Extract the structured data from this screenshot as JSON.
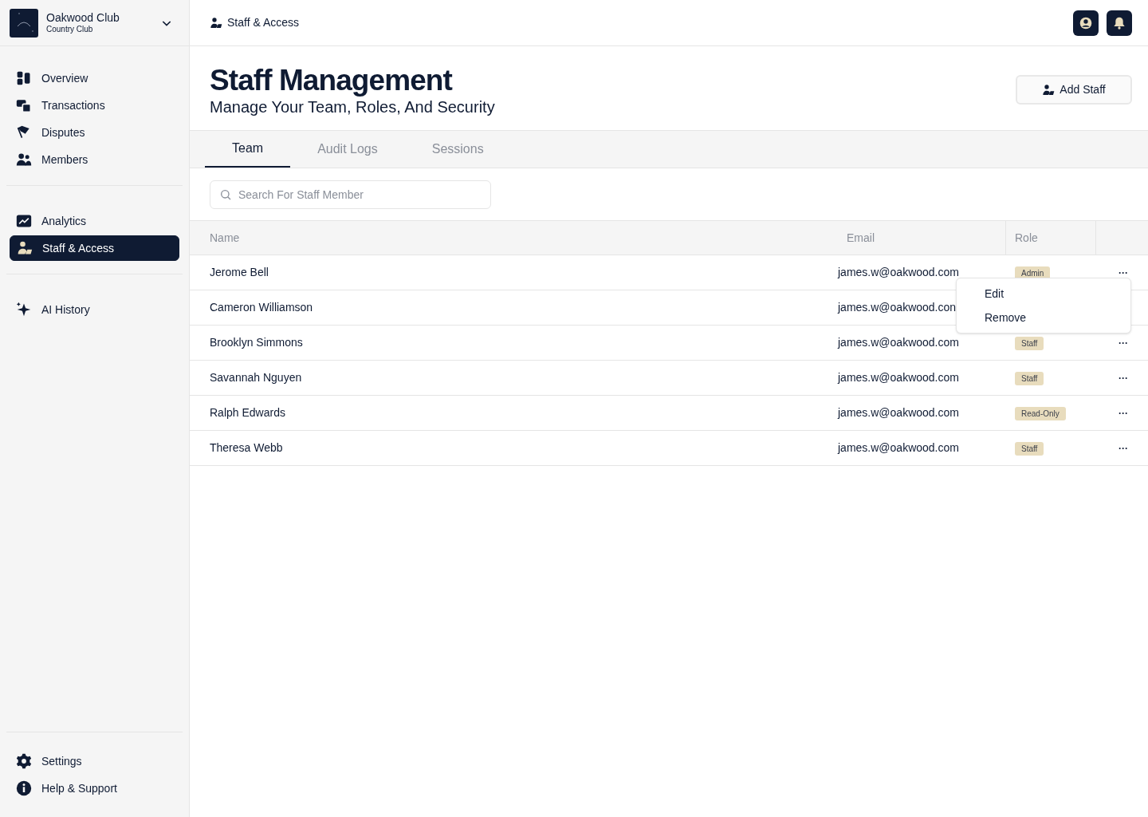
{
  "brand": {
    "name": "Oakwood Club",
    "subtitle": "Country Club"
  },
  "nav_groups": [
    {
      "items": [
        {
          "label": "Overview",
          "selected": false
        },
        {
          "label": "Transactions",
          "selected": false
        },
        {
          "label": "Disputes",
          "selected": false
        },
        {
          "label": "Members",
          "selected": false
        }
      ]
    },
    {
      "items": [
        {
          "label": "Analytics",
          "selected": false
        },
        {
          "label": "Staff & Access",
          "selected": true
        }
      ]
    },
    {
      "items": [
        {
          "label": "AI History",
          "selected": false
        }
      ]
    }
  ],
  "nav_footer": [
    {
      "label": "Settings"
    },
    {
      "label": "Help & Support"
    }
  ],
  "breadcrumb": "Staff & Access",
  "page": {
    "title": "Staff Management",
    "subtitle": "Manage Your Team, Roles, And Security",
    "action": "Add Staff"
  },
  "tabs": [
    {
      "label": "Team",
      "selected": true
    },
    {
      "label": "Audit Logs",
      "selected": false
    },
    {
      "label": "Sessions",
      "selected": false
    }
  ],
  "search": {
    "placeholder": "Search For Staff Member"
  },
  "table": {
    "columns": [
      "Name",
      "Email",
      "Role"
    ],
    "rows": [
      {
        "name": "Jerome Bell",
        "email": "james.w@oakwood.com",
        "role": "Admin",
        "actions": "···"
      },
      {
        "name": "Cameron Williamson",
        "email": "james.w@oakwood.con"
      },
      {
        "name": "Brooklyn Simmons",
        "email": "james.w@oakwood.com",
        "role": "Staff",
        "actions": "···"
      },
      {
        "name": "Savannah Nguyen",
        "email": "james.w@oakwood.com",
        "role": "Staff",
        "actions": "···"
      },
      {
        "name": "Ralph Edwards",
        "email": "james.w@oakwood.com",
        "role": "Read-Only",
        "actions": "···"
      },
      {
        "name": "Theresa Webb",
        "email": "james.w@oakwood.com",
        "role": "Staff",
        "actions": "···"
      }
    ]
  },
  "row_menu": {
    "items": [
      "Edit",
      "Remove"
    ]
  }
}
